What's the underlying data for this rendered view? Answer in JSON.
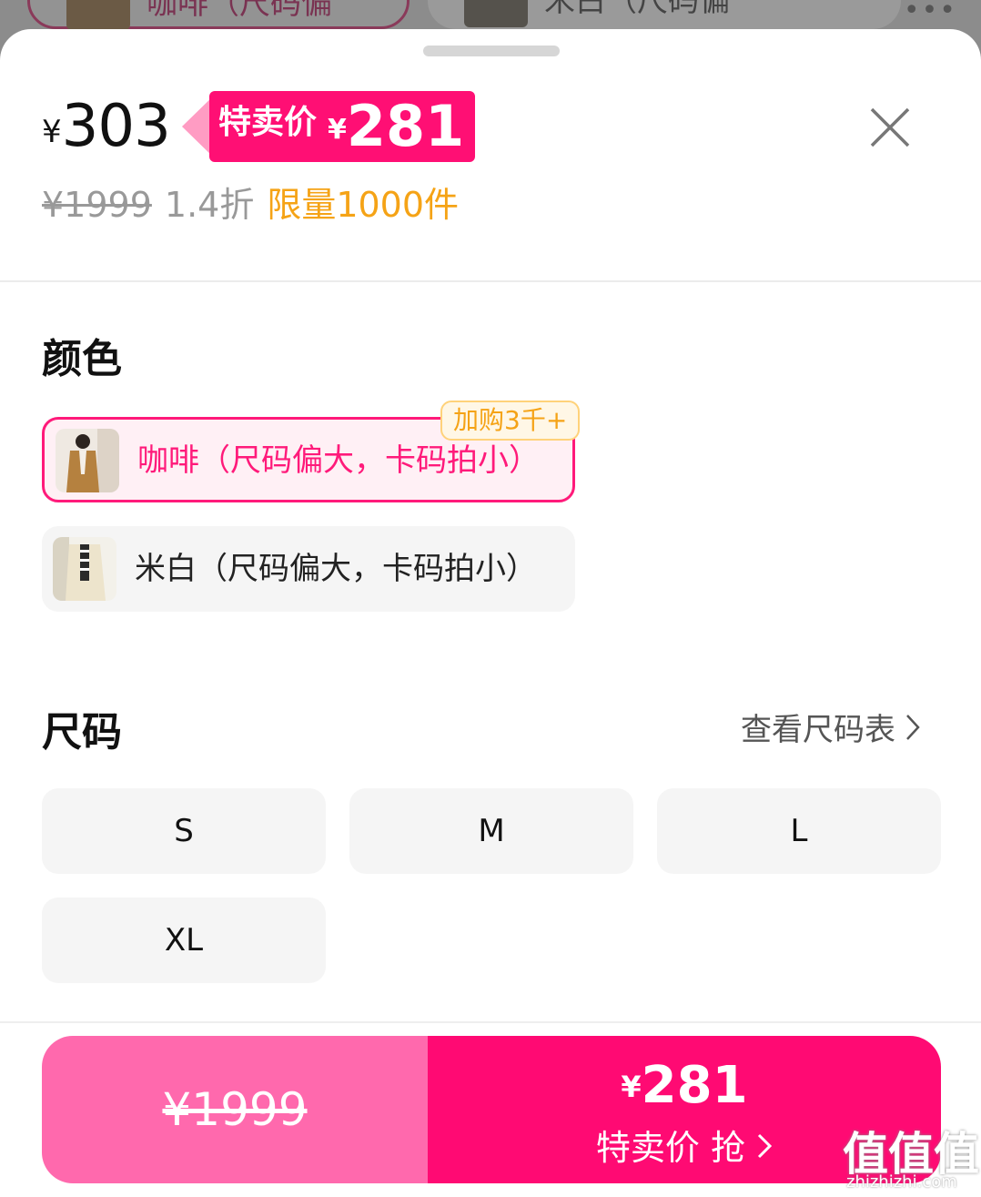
{
  "background": {
    "chip_selected_label": "咖啡（尺码偏",
    "chip_other_label": "米白（尺码偏",
    "more_dots": "•••"
  },
  "price": {
    "currency": "¥",
    "current": "303",
    "special_label": "特卖价",
    "special_currency": "¥",
    "special_value": "281",
    "original": "¥1999",
    "discount": "1.4折",
    "limit": "限量1000件"
  },
  "color_section": {
    "title": "颜色",
    "badge": "加购3千+",
    "options": [
      {
        "label": "咖啡（尺码偏大，卡码拍小）",
        "selected": true
      },
      {
        "label": "米白（尺码偏大，卡码拍小）",
        "selected": false
      }
    ]
  },
  "size_section": {
    "title": "尺码",
    "chart_link": "查看尺码表",
    "options": [
      "S",
      "M",
      "L",
      "XL"
    ]
  },
  "bottom": {
    "original_price": "¥1999",
    "special_currency": "¥",
    "special_price": "281",
    "special_action": "特卖价 抢"
  },
  "watermark": {
    "text": "值值值",
    "sub": "zhizhizhi.com"
  },
  "colors": {
    "brand_pink": "#ff0f74",
    "light_pink": "#ff69ad",
    "orange": "#f5a316"
  }
}
